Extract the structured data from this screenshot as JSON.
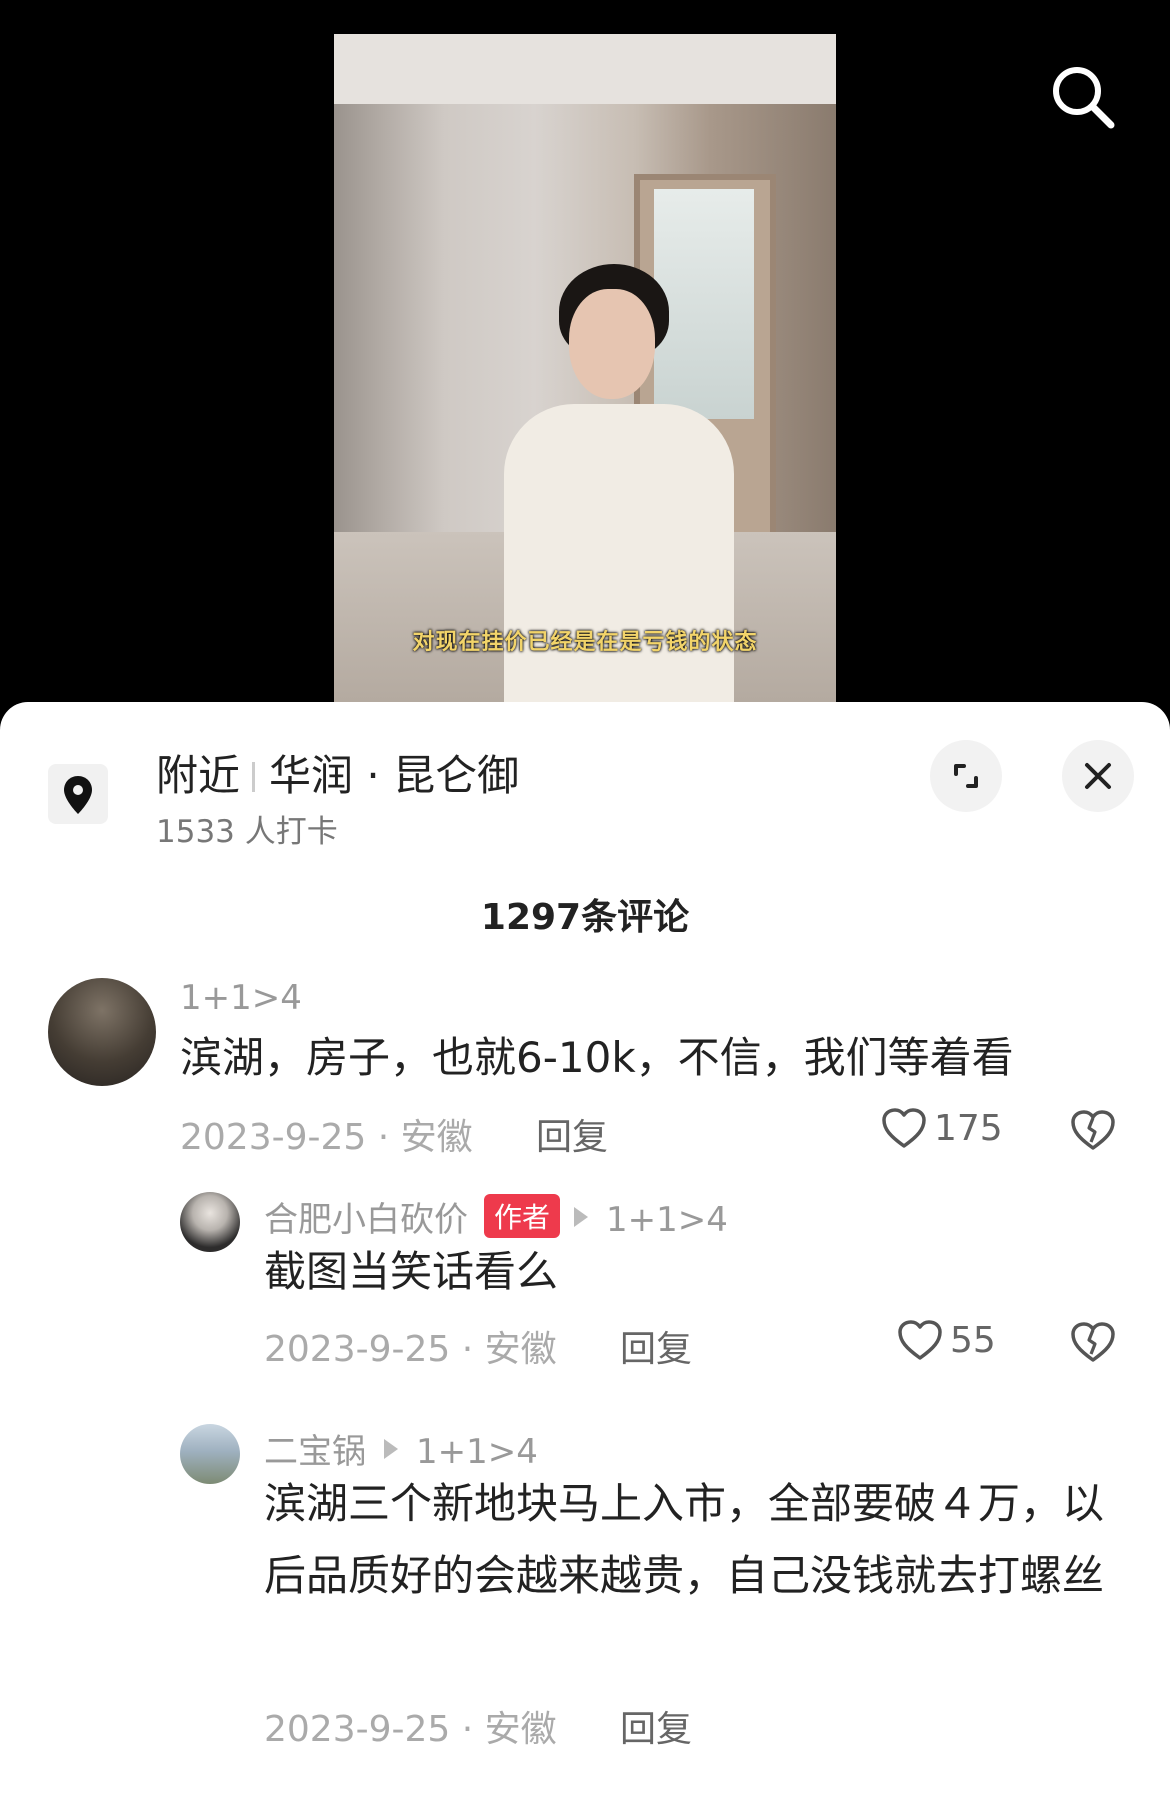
{
  "video": {
    "caption": "对现在挂价已经是在是亏钱的状态"
  },
  "location": {
    "prefix": "附近",
    "name": "华润 · 昆仑御",
    "checkins": "1533 人打卡"
  },
  "comments_count": "1297条评论",
  "comments": [
    {
      "username": "1+1>4",
      "text": "滨湖，房子，也就6-10k，不信，我们等着看",
      "meta": "2023-9-25 · 安徽",
      "reply_label": "回复",
      "likes": "175"
    },
    {
      "username": "合肥小白砍价",
      "badge": "作者",
      "reply_to": "1+1>4",
      "text": "截图当笑话看么",
      "meta": "2023-9-25 · 安徽",
      "reply_label": "回复",
      "likes": "55"
    },
    {
      "username": "二宝锅",
      "reply_to": "1+1>4",
      "text": "滨湖三个新地块马上入市，全部要破４万，以后品质好的会越来越贵，自己没钱就去打螺丝",
      "meta": "2023-9-25 · 安徽",
      "reply_label": "回复"
    }
  ]
}
